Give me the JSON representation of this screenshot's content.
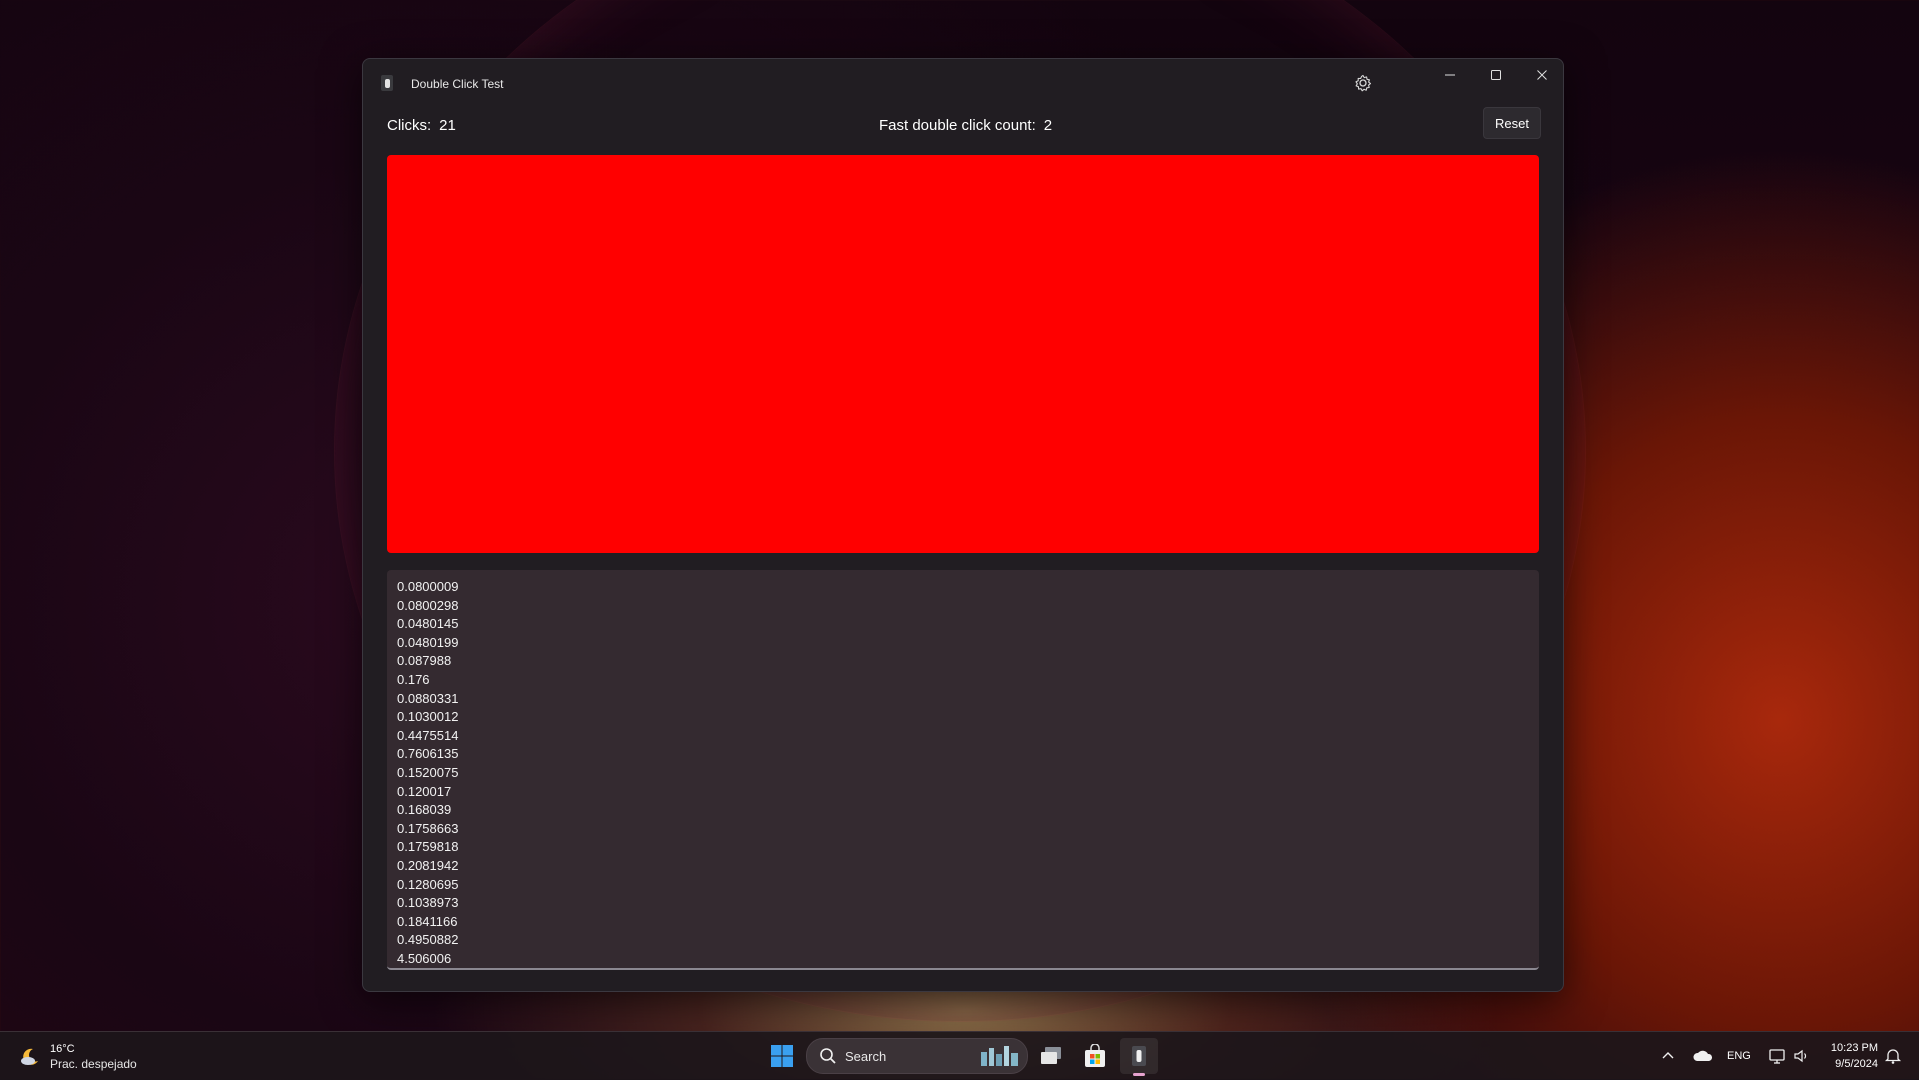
{
  "window": {
    "title": "Double Click Test",
    "clicks_label": "Clicks:",
    "clicks_value": "21",
    "fast_label": "Fast double click count:",
    "fast_value": "2",
    "reset_label": "Reset",
    "click_area_color": "#ff0000",
    "log_values": [
      "0.0800009",
      "0.0800298",
      "0.0480145",
      "0.0480199",
      "0.087988",
      "0.176",
      "0.0880331",
      "0.1030012",
      "0.4475514",
      "0.7606135",
      "0.1520075",
      "0.120017",
      "0.168039",
      "0.1758663",
      "0.1759818",
      "0.2081942",
      "0.1280695",
      "0.1038973",
      "0.1841166",
      "0.4950882",
      "4.506006"
    ]
  },
  "taskbar": {
    "weather_temp": "16°C",
    "weather_condition": "Prac. despejado",
    "search_label": "Search",
    "language": "ENG",
    "time": "10:23 PM",
    "date": "9/5/2024"
  },
  "icons": [
    "app-icon",
    "gear-icon",
    "minimize-icon",
    "maximize-icon",
    "close-icon",
    "weather-icon",
    "windows-start-icon",
    "search-icon",
    "task-view-icon",
    "store-icon",
    "tray-chevron-icon",
    "onedrive-icon",
    "network-icon",
    "volume-icon",
    "notification-icon"
  ]
}
